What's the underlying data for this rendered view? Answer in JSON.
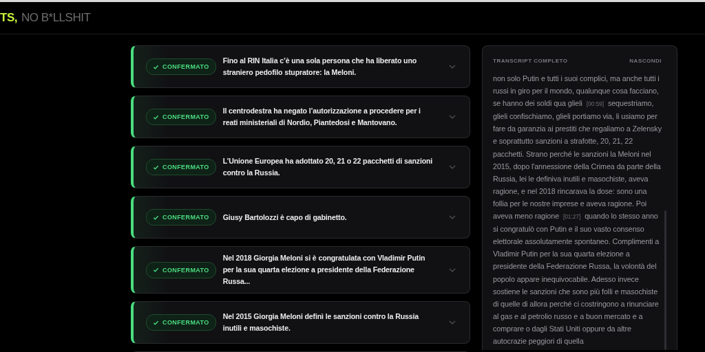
{
  "header": {
    "brand_accent": "TS,",
    "brand_rest": "NO B*LLSHIT"
  },
  "claims": [
    {
      "kind": "confirmed",
      "badge": "CONFERMATO",
      "text": "Fino al RIN Italia c’è una sola persona che ha liberato uno straniero pedofilo stupratore: la Meloni."
    },
    {
      "kind": "confirmed",
      "badge": "CONFERMATO",
      "text": "Il centrodestra ha negato l’autorizzazione a procedere per i reati ministeriali di Nordio, Piantedosi e Mantovano."
    },
    {
      "kind": "confirmed",
      "badge": "CONFERMATO",
      "text": "L’Unione Europea ha adottato 20, 21 o 22 pacchetti di sanzioni contro la Russia."
    },
    {
      "kind": "confirmed",
      "badge": "CONFERMATO",
      "text": "Giusy Bartolozzi è capo di gabinetto."
    },
    {
      "kind": "confirmed",
      "badge": "CONFERMATO",
      "text": "Nel 2018 Giorgia Meloni si è congratulata con Vladimir Putin per la sua quarta elezione a presidente della Federazione Russa..."
    },
    {
      "kind": "confirmed",
      "badge": "CONFERMATO",
      "text": "Nel 2015 Giorgia Meloni definì le sanzioni contro la Russia inutili e masochiste."
    }
  ],
  "transcript": {
    "title": "TRANSCRIPT COMPLETO",
    "toggle": "NASCONDI",
    "segments": [
      {
        "kind": "text",
        "text": "non solo Putin e tutti i suoi complici, ma anche tutti i russi in giro per il mondo, qualunque cosa facciano, se hanno dei soldi qua glieli"
      },
      {
        "kind": "timestamp",
        "text": "[00:59]"
      },
      {
        "kind": "text",
        "text": "sequestriamo, glieli confischiamo, glieli portiamo via, li usiamo per fare da garanzia ai prestiti che regaliamo a Zelensky e soprattutto sanzioni a strafotte, 20, 21, 22 pacchetti. Strano perché le sanzioni la Meloni nel 2015, dopo l'annessione della Crimea da parte della Russia, lei le definiva inutili e masochiste, aveva ragione, e nel 2018 rincarava la dose: sono una follia per le nostre imprese e aveva ragione. Poi aveva meno ragione"
      },
      {
        "kind": "timestamp",
        "text": "[01:27]"
      },
      {
        "kind": "text",
        "text": "quando lo stesso anno si congratulò con Putin e il suo vasto consenso elettorale assolutamente spontaneo. Complimenti a Vladimir Putin per la sua quarta elezione a presidente della Federazione Russa, la volontà del popolo appare inequivocabile. Adesso invece sostiene le sanzioni che sono più folli e masochiste di quelle di allora perché ci costringono a rinunciare al gas e al petrolio russo e a buon mercato e a comprare o dagli Stati Uniti oppure da altre autocrazie peggiori di quella"
      }
    ]
  }
}
